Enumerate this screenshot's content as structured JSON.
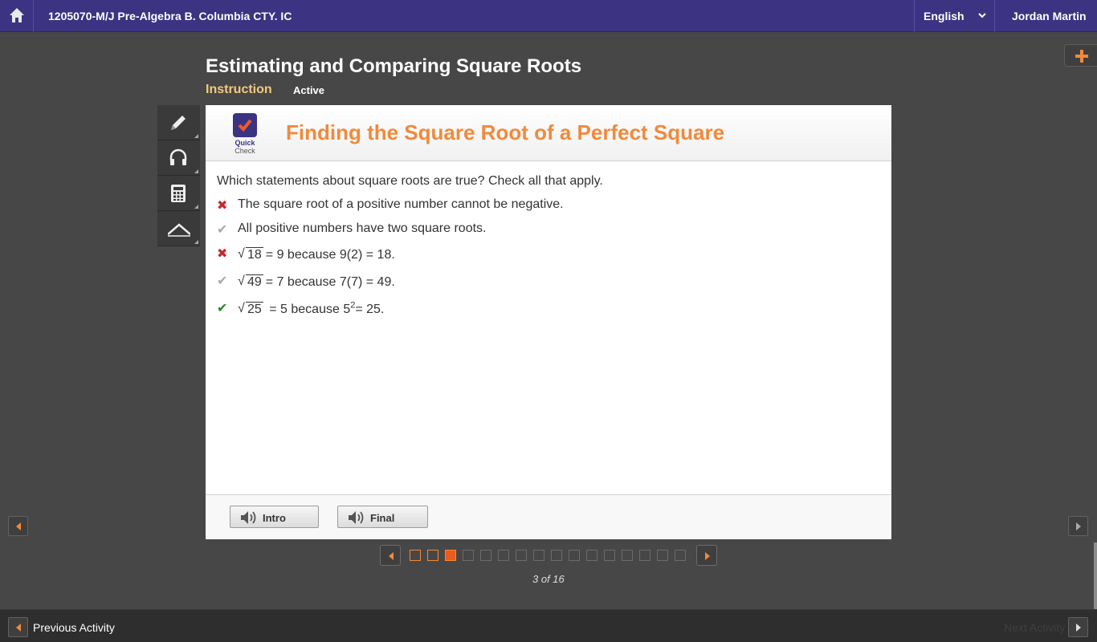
{
  "header": {
    "course": "1205070-M/J Pre-Algebra B. Columbia CTY. IC",
    "language": "English",
    "user": "Jordan Martin"
  },
  "lesson": {
    "title": "Estimating and Comparing Square Roots",
    "tab": "Instruction",
    "status": "Active"
  },
  "activity": {
    "badge_top": "Quick",
    "badge_bottom": "Check",
    "title": "Finding the Square Root of a Perfect Square",
    "question": "Which statements about square roots are true? Check all that apply.",
    "options": [
      {
        "mark": "wrong",
        "text": "The square root of a positive number cannot be negative."
      },
      {
        "mark": "neutral",
        "text": "All positive numbers have two square roots."
      },
      {
        "mark": "wrong",
        "radicand": "18",
        "text": "= 9 because 9(2) = 18."
      },
      {
        "mark": "neutral",
        "radicand": "49",
        "text": "= 7 because 7(7) = 49."
      },
      {
        "mark": "right",
        "radicand": "25",
        "text_pre": "= 5 because 5",
        "sup": "2",
        "text_post": "= 25."
      }
    ],
    "audio_buttons": [
      "Intro",
      "Final"
    ]
  },
  "pager": {
    "count_label": "3 of 16",
    "total": 16,
    "current": 3
  },
  "footer": {
    "prev_label": "Previous Activity",
    "next_label": "Next Activity"
  },
  "colors": {
    "topbar": "#3c3383",
    "accent_orange": "#f08a3c",
    "wrong": "#c8282d",
    "right": "#1d8a2a"
  }
}
